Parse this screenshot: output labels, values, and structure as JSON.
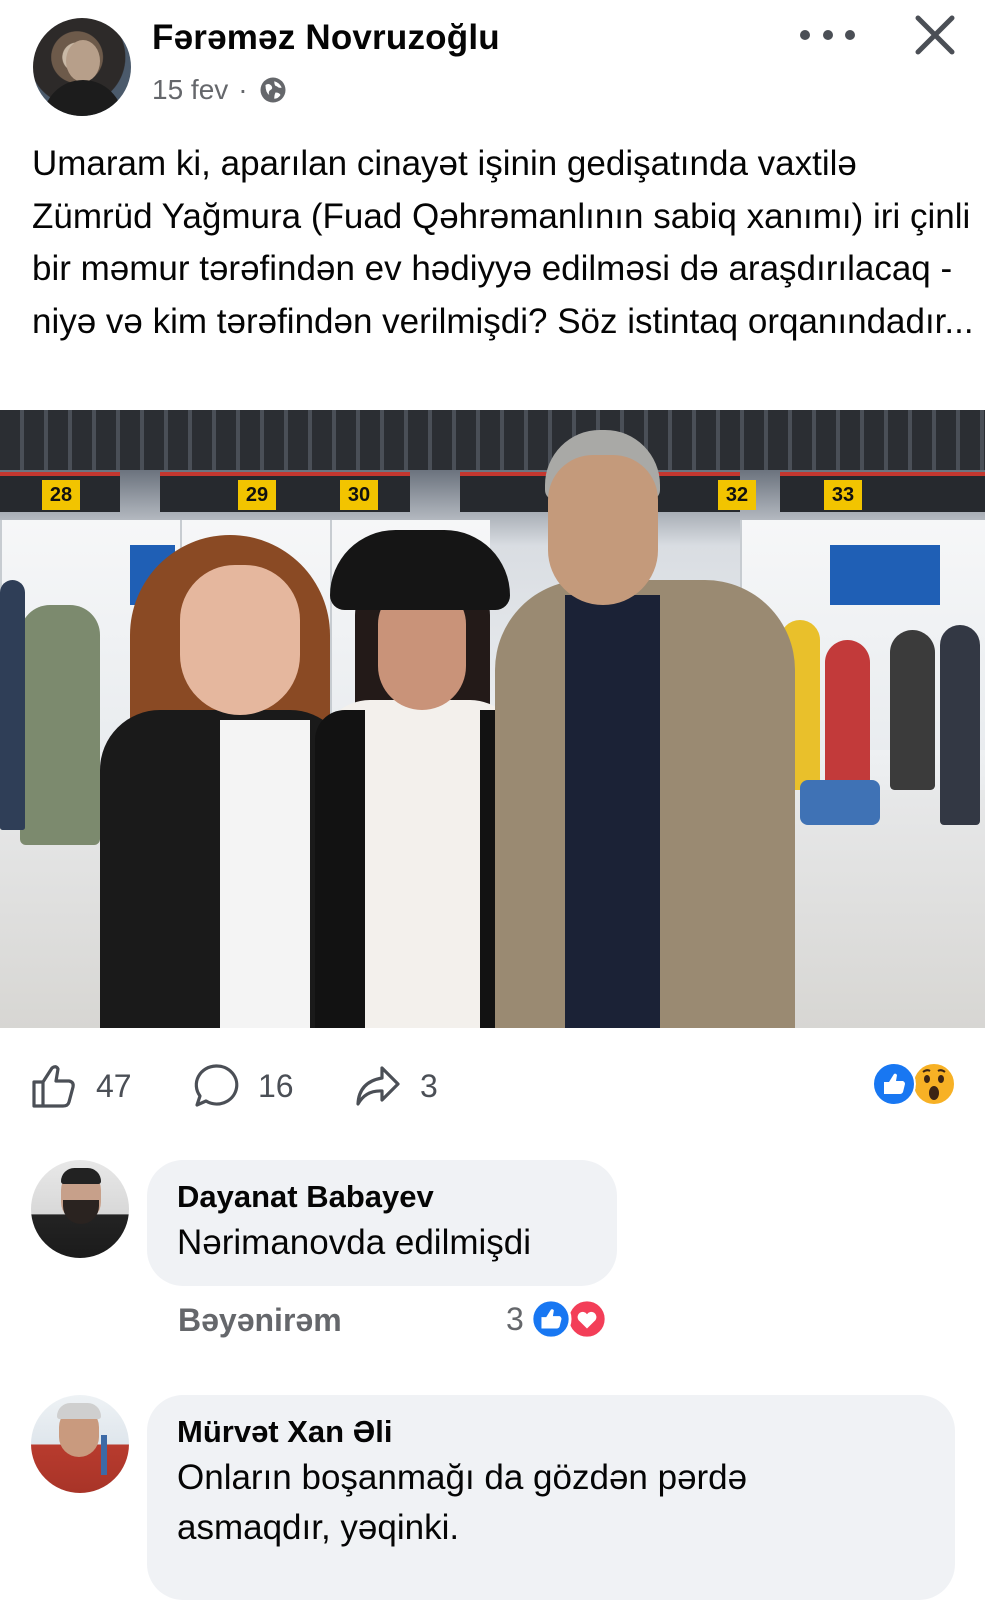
{
  "post": {
    "author": "Fərəməz Novruzoğlu",
    "date": "15 fev",
    "separator": "·",
    "privacy_icon": "globe-icon",
    "text": "Umaram ki, aparılan cinayət işinin gedişatında vaxtilə Zümrüd Yağmura (Fuad Qəhrəmanlının sabiq xanımı) iri çinli bir məmur tərəfindən ev hədiyyə edilməsi də araşdırılacaq - niyə və kim tərəfindən verilmişdi? Söz istintaq orqanındadır...",
    "photo": {
      "counter_numbers": [
        "28",
        "29",
        "30",
        "32",
        "33"
      ]
    }
  },
  "actions": {
    "like_count": "47",
    "comment_count": "16",
    "share_count": "3"
  },
  "reactions": [
    "like-icon",
    "wow-icon"
  ],
  "colors": {
    "like_blue": "#1877f2",
    "love_red": "#f33e58",
    "wow_yellow": "#f7b125",
    "bubble_bg": "#f0f2f5",
    "muted_text": "#65676b"
  },
  "comments": [
    {
      "name": "Dayanat Babayev",
      "text": "Nərimanovda edilmişdi",
      "like_label": "Bəyənirəm",
      "reaction_count": "3",
      "reactions": [
        "like-icon",
        "love-icon"
      ]
    },
    {
      "name": "Mürvət Xan Əli",
      "text_line1": "Onların boşanmağı da gözdən pərdə",
      "text_line2": "asmaqdır, yəqinki."
    }
  ]
}
